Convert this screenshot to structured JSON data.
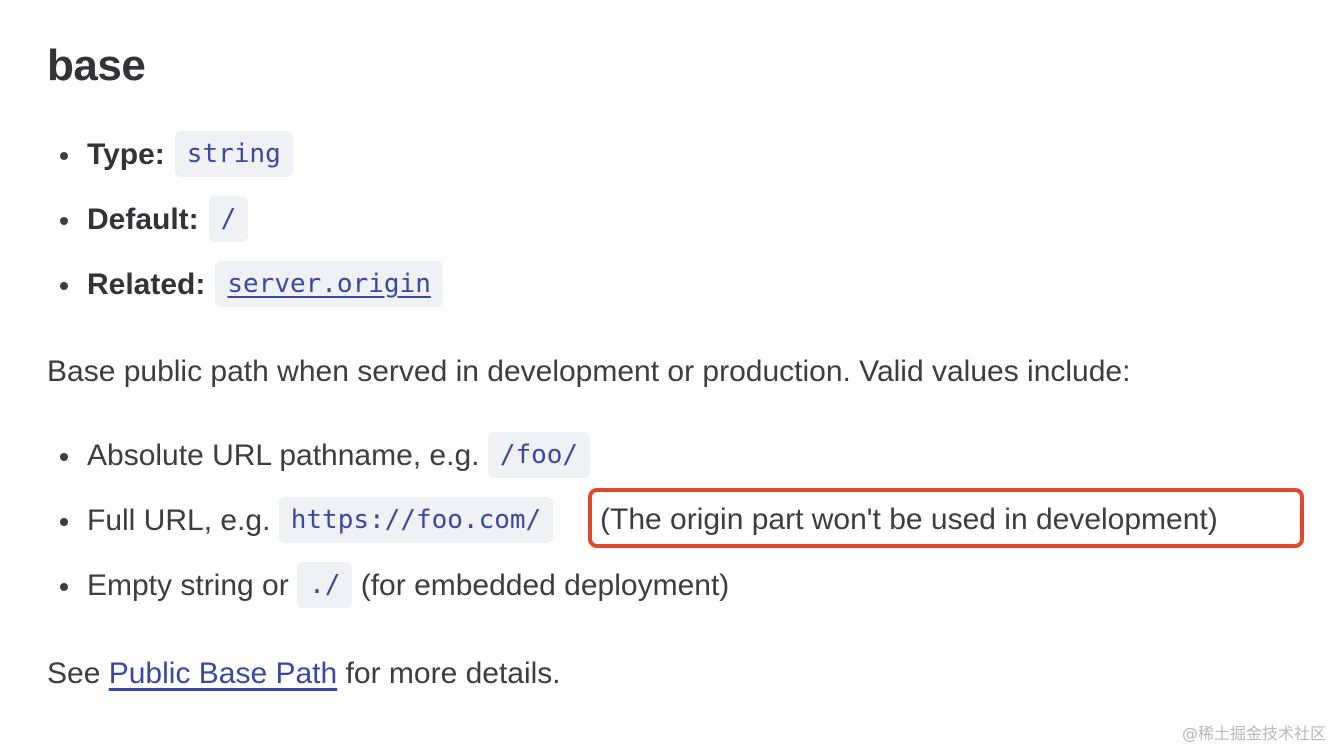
{
  "heading": "base",
  "meta": {
    "type_label": "Type:",
    "type_value": "string",
    "default_label": "Default:",
    "default_value": "/",
    "related_label": "Related:",
    "related_value": "server.origin"
  },
  "intro": "Base public path when served in development or production. Valid values include:",
  "values": {
    "item1_text": "Absolute URL pathname, e.g.",
    "item1_code": "/foo/",
    "item2_text": "Full URL, e.g.",
    "item2_code": "https://foo.com/",
    "item2_note": "(The origin part won't be used in development)",
    "item3_text": "Empty string or",
    "item3_code": "./",
    "item3_suffix": "(for embedded deployment)"
  },
  "see": {
    "prefix": "See",
    "link": "Public Base Path",
    "suffix": "for more details."
  },
  "watermark": "@稀土掘金技术社区",
  "colors": {
    "highlight_box": "#e1482d",
    "link": "#3a48a3",
    "code_bg": "#f0f1f4"
  }
}
